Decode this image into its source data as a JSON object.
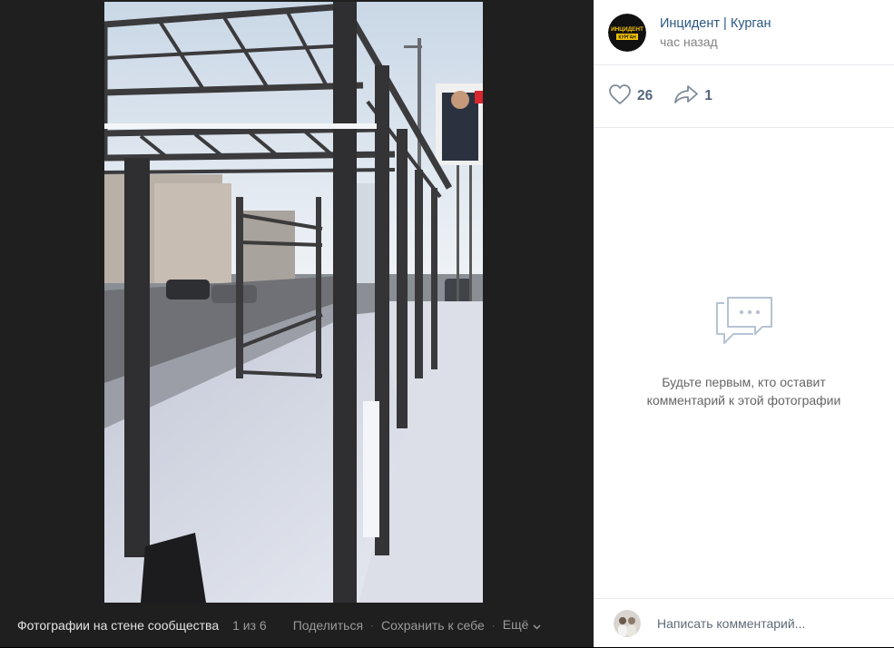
{
  "footer": {
    "album_label": "Фотографии на стене сообщества",
    "counter": "1 из 6",
    "share_label": "Поделиться",
    "save_label": "Сохранить к себе",
    "more_label": "Ещё",
    "separator": "·"
  },
  "post": {
    "author": "Инцидент | Курган",
    "time": "час назад",
    "avatar_logo_top": "ИНЦИДЕНТ",
    "avatar_logo_bottom": "КУРГАН"
  },
  "actions": {
    "likes": "26",
    "shares": "1"
  },
  "comments": {
    "empty_line1": "Будьте первым, кто оставит",
    "empty_line2": "комментарий к этой фотографии",
    "placeholder": "Написать комментарий..."
  },
  "colors": {
    "viewer_bg": "#1f1f1f",
    "link": "#2a5885",
    "accent_yellow": "#f5c400"
  },
  "icons": {
    "like": "heart-icon",
    "share": "share-arrow-icon",
    "empty": "comment-bubbles-icon",
    "more": "chevron-down-icon"
  }
}
